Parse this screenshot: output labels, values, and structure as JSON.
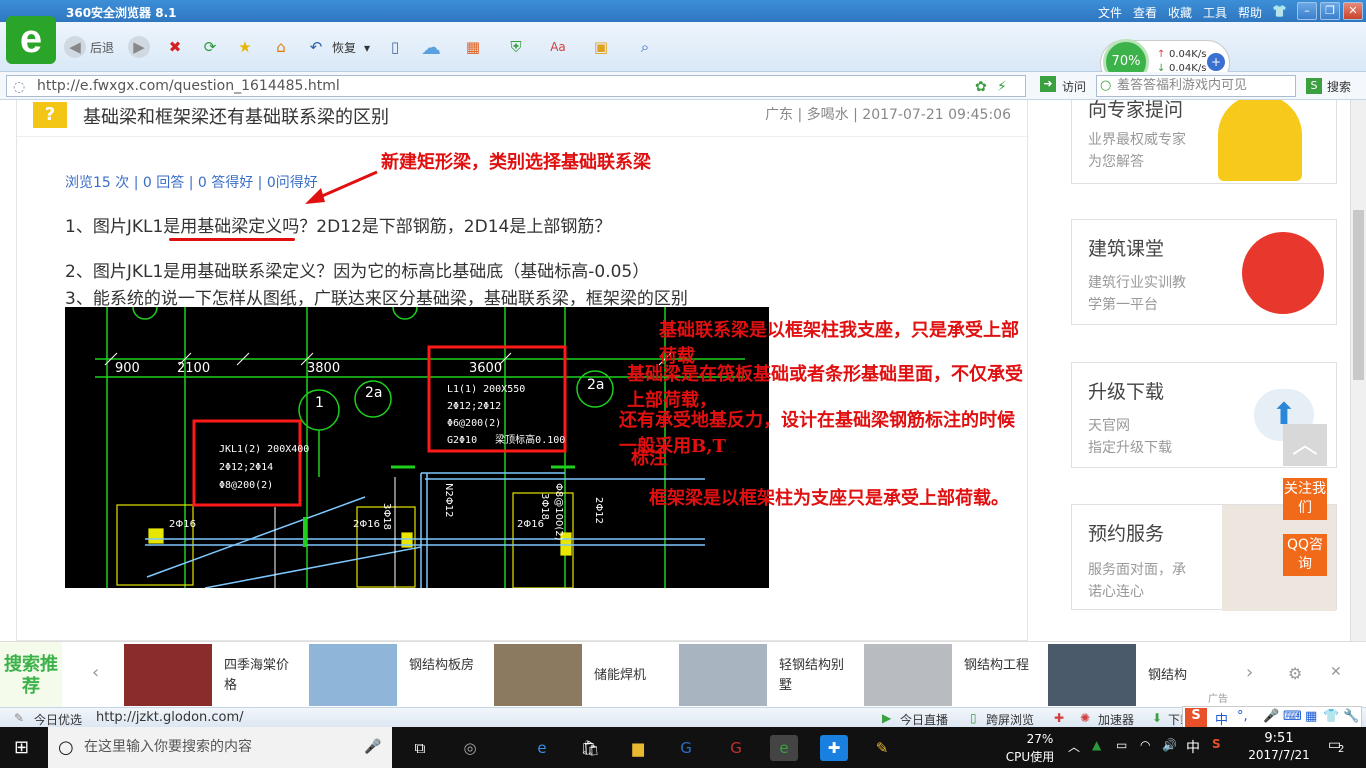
{
  "browser": {
    "title": "360安全浏览器 8.1",
    "menu": [
      "文件",
      "查看",
      "收藏",
      "工具",
      "帮助"
    ],
    "back": "后退",
    "restore": "恢复",
    "visit": "访问",
    "search_btn": "搜索",
    "search_text": "羞答答福利游戏内可见",
    "url": "http://e.fwxgx.com/question_1614485.html",
    "speed": {
      "percent": "70%",
      "up": "0.04K/s",
      "down": "0.04K/s"
    }
  },
  "question": {
    "title": "基础梁和框架梁还有基础联系梁的区别",
    "meta": "广东 | 多喝水 | 2017-07-21 09:45:06",
    "stats": "浏览15 次 | 0 回答 | 0 答得好 | 0问得好",
    "lines": [
      "1、图片JKL1是用基础梁定义吗？2D12是下部钢筋，2D14是上部钢筋？",
      "2、图片JKL1是用基础联系梁定义？因为它的标高比基础底（基础标高-0.05）",
      "3、能系统的说一下怎样从图纸，广联达来区分基础梁，基础联系梁，框架梁的区别"
    ]
  },
  "annotations": {
    "arrow_note": "新建矩形梁，类别选择基础联系梁",
    "notes": [
      "基础联系梁是以框架柱我支座，只是承受上部荷载",
      "基础梁是在筏板基础或者条形基础里面，不仅承受上部荷载，",
      "还有承受地基反力，设计在基础梁钢筋标注的时候一般采用B,T",
      "标注",
      "框架梁是以框架柱为支座只是承受上部荷载。"
    ]
  },
  "cad": {
    "dims": [
      "900",
      "2100",
      "3800",
      "3600"
    ],
    "axes": [
      "1",
      "2a",
      "2a"
    ],
    "jkl": [
      "JKL1(2) 200X400",
      "2Φ12;2Φ14",
      "Φ8@200(2)"
    ],
    "l1": [
      "L1(1) 200X550",
      "2Φ12;2Φ12",
      "Φ6@200(2)",
      "G2Φ10",
      "梁顶标高0.100"
    ],
    "small": [
      "2Φ16",
      "2Φ16",
      "2Φ16",
      "3Φ18",
      "3Φ18",
      "Φ8@100(2)",
      "N2Φ12",
      "2Φ12"
    ]
  },
  "side": {
    "expert": {
      "title": "向专家提问",
      "l1": "业界最权威专家",
      "l2": "为您解答"
    },
    "class": {
      "title": "建筑课堂",
      "l1": "建筑行业实训教",
      "l2": "学第一平台"
    },
    "upgrade": {
      "title": "升级下载",
      "l1": "天官网",
      "l2": "指定升级下载"
    },
    "book": {
      "title": "预约服务",
      "l1": "服务面对面，承",
      "l2": "诺心连心"
    },
    "follow": "关注我们",
    "qq": "QQ咨询"
  },
  "promo": {
    "label": "搜索推荐",
    "items": [
      "四季海棠价格",
      "钢结构板房",
      "储能焊机",
      "轻钢结构别墅",
      "钢结构工程",
      "钢结构"
    ],
    "ad": "广告"
  },
  "status": {
    "left": "今日优选",
    "url": "http://jzkt.glodon.com/",
    "live": "今日直播",
    "cross": "跨屏浏览",
    "accel": "加速器",
    "down": "下载"
  },
  "taskbar": {
    "search": "在这里输入你要搜索的内容",
    "cpu_pct": "27%",
    "cpu_label": "CPU使用",
    "ime": "中",
    "time": "9:51",
    "date": "2017/7/21",
    "notif": "2"
  }
}
